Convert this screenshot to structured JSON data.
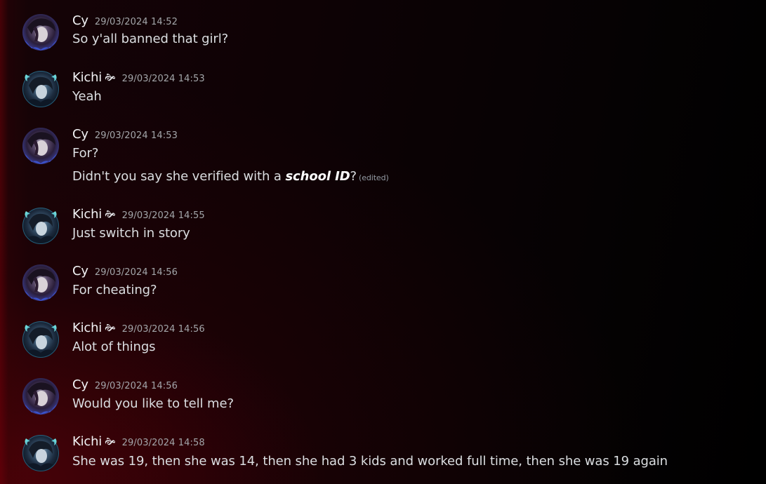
{
  "messages": [
    {
      "user": "Cy",
      "badge": "",
      "time": "29/03/2024 14:52",
      "avatar": "cy-avatar",
      "lines": [
        "So y'all banned that girl?"
      ]
    },
    {
      "user": "Kichi",
      "badge": "🙞",
      "time": "29/03/2024 14:53",
      "avatar": "kichi-avatar",
      "lines": [
        "Yeah"
      ]
    },
    {
      "user": "Cy",
      "badge": "",
      "time": "29/03/2024 14:53",
      "avatar": "cy-avatar",
      "lines": [
        "For?"
      ],
      "edited_line": {
        "before": "Didn't you say she verified with a ",
        "emphasis": "school ID",
        "after": "?",
        "edited": "(edited)"
      }
    },
    {
      "user": "Kichi",
      "badge": "🙞",
      "time": "29/03/2024 14:55",
      "avatar": "kichi-avatar",
      "lines": [
        "Just switch in story"
      ]
    },
    {
      "user": "Cy",
      "badge": "",
      "time": "29/03/2024 14:56",
      "avatar": "cy-avatar",
      "lines": [
        "For cheating?"
      ]
    },
    {
      "user": "Kichi",
      "badge": "🙞",
      "time": "29/03/2024 14:56",
      "avatar": "kichi-avatar",
      "lines": [
        "Alot of things"
      ]
    },
    {
      "user": "Cy",
      "badge": "",
      "time": "29/03/2024 14:56",
      "avatar": "cy-avatar",
      "lines": [
        "Would you like to tell me?"
      ]
    },
    {
      "user": "Kichi",
      "badge": "🙞",
      "time": "29/03/2024 14:58",
      "avatar": "kichi-avatar",
      "lines": [
        "She was 19, then she was 14, then she had 3 kids and worked full time, then she was 19 again"
      ]
    }
  ],
  "colors": {
    "username": "#f2f3f5",
    "timestamp": "#a3a6aa",
    "message_text": "#dbdee1",
    "edited": "#949ba4"
  }
}
